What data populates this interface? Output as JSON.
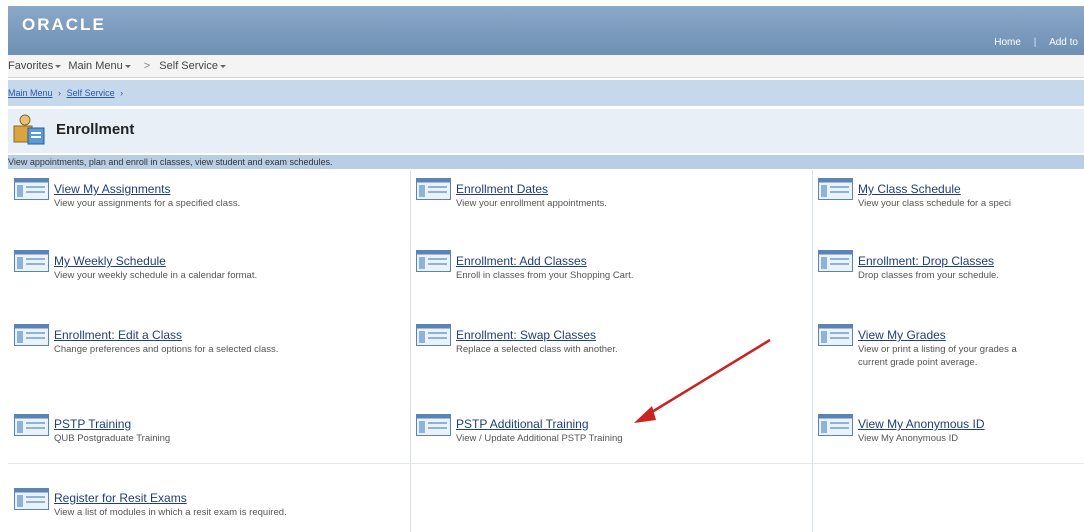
{
  "header": {
    "logo": "ORACLE",
    "links": [
      "Home",
      "Add to"
    ]
  },
  "menubar": {
    "items": [
      "Favorites",
      "Main Menu",
      "Self Service"
    ],
    "separator": ">"
  },
  "breadcrumb": {
    "items": [
      "Main Menu",
      "Self Service"
    ],
    "separator": "›"
  },
  "page": {
    "title": "Enrollment",
    "description": "View appointments, plan and enroll in classes, view student and exam schedules."
  },
  "tiles": [
    {
      "title": "View My Assignments",
      "desc": "View your assignments for a specified class."
    },
    {
      "title": "Enrollment Dates",
      "desc": "View your enrollment appointments."
    },
    {
      "title": "My Class Schedule",
      "desc": "View your class schedule for a speci"
    },
    {
      "title": "My Weekly Schedule",
      "desc": "View your weekly schedule in a calendar format."
    },
    {
      "title": "Enrollment: Add Classes",
      "desc": "Enroll in classes from your Shopping Cart."
    },
    {
      "title": "Enrollment: Drop Classes",
      "desc": "Drop classes from your schedule."
    },
    {
      "title": "Enrollment: Edit a Class",
      "desc": "Change preferences and options for a selected class."
    },
    {
      "title": "Enrollment: Swap Classes",
      "desc": "Replace a selected class with another."
    },
    {
      "title": "View My Grades",
      "desc": "View or print a listing of your grades a",
      "desc2": "current grade point average."
    },
    {
      "title": "PSTP Training",
      "desc": "QUB Postgraduate Training"
    },
    {
      "title": "PSTP Additional Training",
      "desc": "View / Update Additional PSTP Training"
    },
    {
      "title": "View My Anonymous ID",
      "desc": "View My Anonymous ID"
    },
    {
      "title": "Register for Resit Exams",
      "desc": "View a list of modules in which a resit exam is required."
    }
  ],
  "colors": {
    "header": "#7a98bd",
    "breadcrumb_bar": "#c6d8ec",
    "link": "#1f3f7a",
    "annotation_arrow": "#cc2222"
  }
}
